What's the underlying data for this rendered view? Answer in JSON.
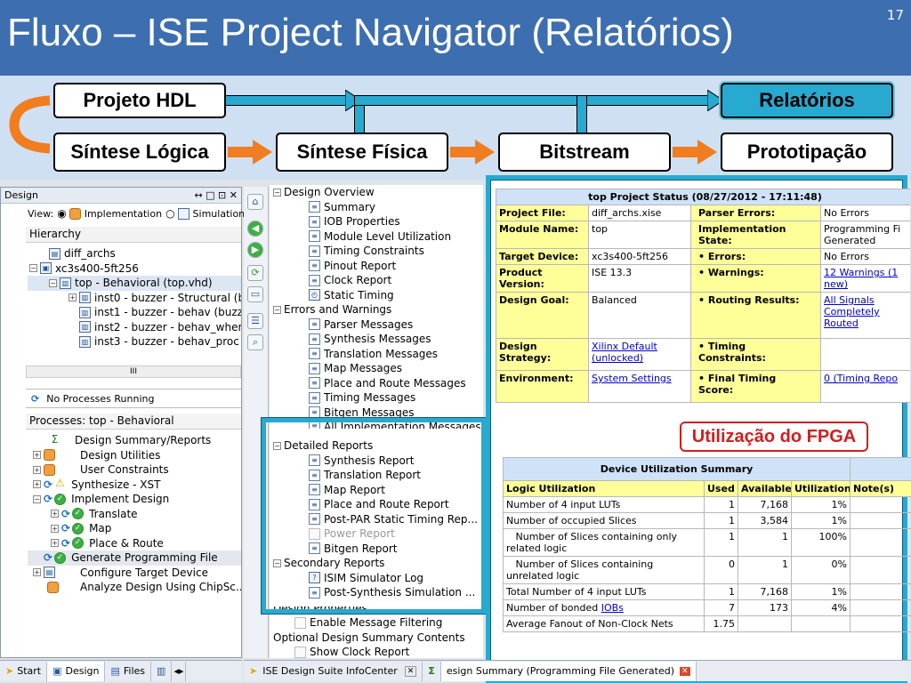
{
  "slide": {
    "title": "Fluxo – ISE Project Navigator (Relatórios)",
    "number": "17"
  },
  "flow": {
    "projeto": "Projeto HDL",
    "relatorios": "Relatórios",
    "sintese_logica": "Síntese Lógica",
    "sintese_fisica": "Síntese Física",
    "bitstream": "Bitstream",
    "prototipacao": "Prototipação"
  },
  "design": {
    "panel_title": "Design",
    "panel_ctrl": "↔ □ ⊡ ✕",
    "view_label": "View:",
    "view_impl": "Implementation",
    "view_sim": "Simulation",
    "hierarchy": "Hierarchy",
    "tree": [
      "diff_archs",
      "xc3s400-5ft256",
      "top - Behavioral (top.vhd)",
      "inst0 - buzzer - Structural (bu",
      "inst1 - buzzer - behav (buzze",
      "inst2 - buzzer - behav_when",
      "inst3 - buzzer - behav_proc ("
    ],
    "scroll_label": "III",
    "no_processes": "No Processes Running",
    "processes_title": "Processes: top - Behavioral",
    "processes": [
      "Design Summary/Reports",
      "Design Utilities",
      "User Constraints",
      "Synthesize - XST",
      "Implement Design",
      "Translate",
      "Map",
      "Place & Route",
      "Generate Programming File",
      "Configure Target Device",
      "Analyze Design Using ChipSc..."
    ]
  },
  "overview": {
    "design_overview": "Design Overview",
    "items1": [
      "Summary",
      "IOB Properties",
      "Module Level Utilization",
      "Timing Constraints",
      "Pinout Report",
      "Clock Report",
      "Static Timing"
    ],
    "errors_warnings": "Errors and Warnings",
    "items2": [
      "Parser Messages",
      "Synthesis Messages",
      "Translation Messages",
      "Map Messages",
      "Place and Route Messages",
      "Timing Messages",
      "Bitgen Messages",
      "All Implementation Messages"
    ],
    "detailed_reports": "Detailed Reports",
    "items3": [
      "Synthesis Report",
      "Translation Report",
      "Map Report",
      "Place and Route Report",
      "Post-PAR Static Timing Rep...",
      "Power Report",
      "Bitgen Report"
    ],
    "secondary_reports": "Secondary Reports",
    "items4": [
      "ISIM Simulator Log",
      "Post-Synthesis Simulation ..."
    ],
    "design_properties": "Design Properties",
    "enable_msg": "Enable Message Filtering",
    "optional": "Optional Design Summary Contents",
    "show_clock": "Show Clock Report"
  },
  "status": {
    "title": "top Project Status (08/27/2012 - 17:11:48)",
    "rows": [
      {
        "k1": "Project File:",
        "v1": "diff_archs.xise",
        "k2": "Parser Errors:",
        "v2": "No Errors"
      },
      {
        "k1": "Module Name:",
        "v1": "top",
        "k2": "Implementation State:",
        "v2": "Programming Fi\nGenerated"
      },
      {
        "k1": "Target Device:",
        "v1": "xc3s400-5ft256",
        "k2": "• Errors:",
        "v2": "No Errors"
      },
      {
        "k1": "Product Version:",
        "v1": "ISE 13.3",
        "k2": "• Warnings:",
        "v2": "12 Warnings (1\nnew)"
      },
      {
        "k1": "Design Goal:",
        "v1": "Balanced",
        "k2": "• Routing Results:",
        "v2": "All Signals\nCompletely\nRouted"
      },
      {
        "k1": "Design Strategy:",
        "v1": "Xilinx Default\n(unlocked)",
        "k2": "• Timing\nConstraints:",
        "v2": ""
      },
      {
        "k1": "Environment:",
        "v1": "System Settings",
        "k2": "• Final Timing\nScore:",
        "v2": "0  (Timing Repo"
      }
    ]
  },
  "util": {
    "title": "Device Utilization Summary",
    "headers": [
      "Logic Utilization",
      "Used",
      "Available",
      "Utilization",
      "Note(s)"
    ],
    "rows": [
      [
        "Number of 4 input LUTs",
        "1",
        "7,168",
        "1%",
        ""
      ],
      [
        "Number of occupied Slices",
        "1",
        "3,584",
        "1%",
        ""
      ],
      [
        "   Number of Slices containing only related logic",
        "1",
        "1",
        "100%",
        ""
      ],
      [
        "   Number of Slices containing unrelated logic",
        "0",
        "1",
        "0%",
        ""
      ],
      [
        "Total Number of 4 input LUTs",
        "1",
        "7,168",
        "1%",
        ""
      ],
      [
        "Number of bonded IOBs",
        "7",
        "173",
        "4%",
        ""
      ],
      [
        "Average Fanout of Non-Clock Nets",
        "1.75",
        "",
        "",
        ""
      ]
    ]
  },
  "callout": "Utilização do FPGA",
  "tabs": {
    "start": "Start",
    "design": "Design",
    "files": "Files",
    "infocenter": "ISE Design Suite InfoCenter",
    "summary_tab": "esign Summary (Programming File Generated)"
  }
}
